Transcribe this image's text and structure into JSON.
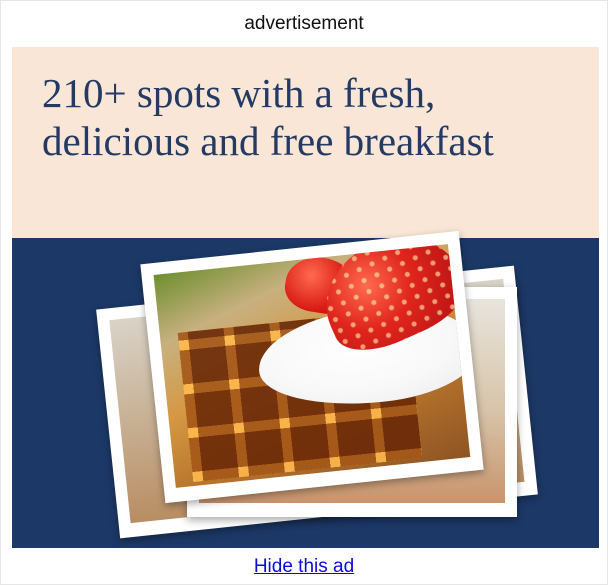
{
  "ad": {
    "header_label": "advertisement",
    "headline_line1": "210+ spots with a fresh,",
    "headline_line2": "delicious and free breakfast",
    "image_subject": "stacked photos of a waffle topped with whipped cream and strawberries",
    "hide_link": "Hide this ad",
    "colors": {
      "top_panel": "#f9e6d6",
      "bottom_panel": "#1c3866",
      "headline_text": "#243a63",
      "link": "#0b0bd8"
    }
  }
}
